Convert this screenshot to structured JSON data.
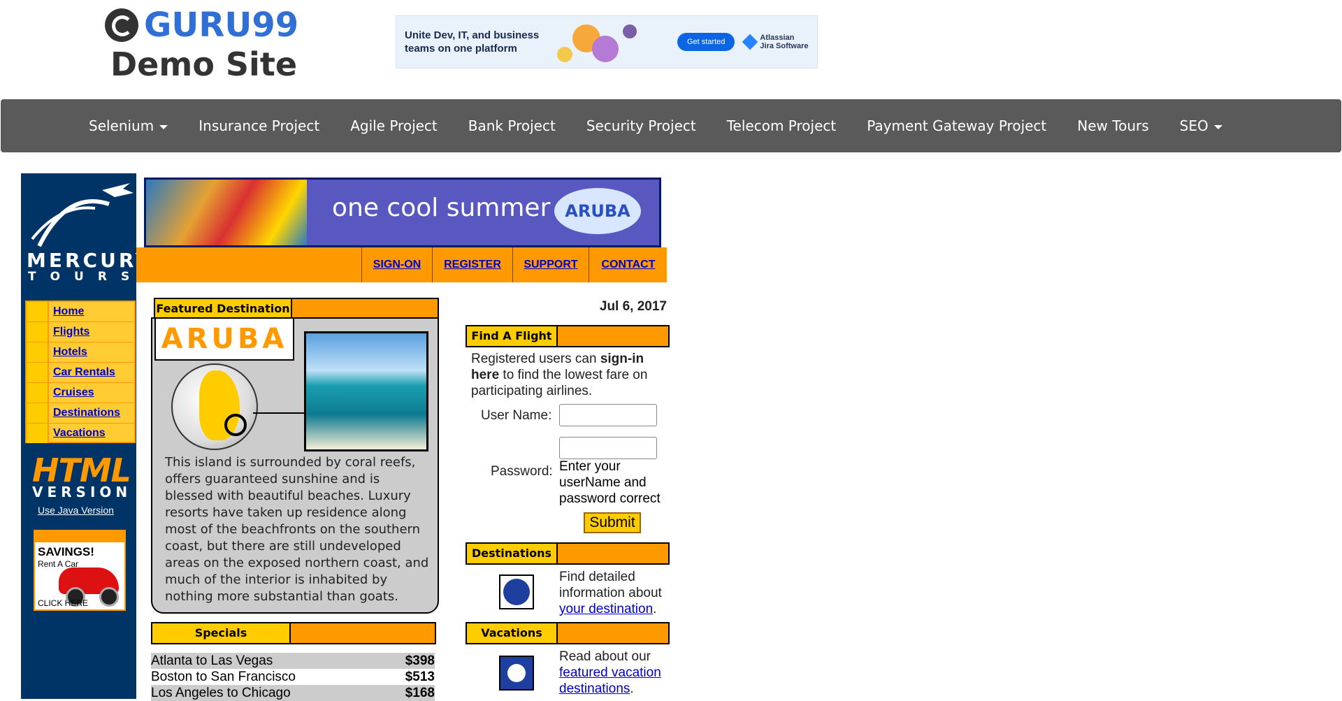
{
  "header": {
    "logo_text": "GURU99",
    "subtitle": "Demo Site"
  },
  "ad": {
    "text": "Unite Dev, IT, and business teams on one platform",
    "button": "Get started",
    "brand_line1": "Atlassian",
    "brand_line2": "Jira Software"
  },
  "nav": {
    "items": [
      {
        "label": "Selenium",
        "dropdown": true
      },
      {
        "label": "Insurance Project"
      },
      {
        "label": "Agile Project"
      },
      {
        "label": "Bank Project"
      },
      {
        "label": "Security Project"
      },
      {
        "label": "Telecom Project"
      },
      {
        "label": "Payment Gateway Project"
      },
      {
        "label": "New Tours"
      },
      {
        "label": "SEO",
        "dropdown": true
      }
    ]
  },
  "mercury": {
    "logo_word": "MERCURY",
    "logo_sub": "TOURS",
    "banner_slogan": "one cool summer",
    "banner_badge": "ARUBA",
    "top_links": [
      "SIGN-ON",
      "REGISTER",
      "SUPPORT",
      "CONTACT"
    ],
    "side_menu": [
      "Home",
      "Flights",
      "Hotels",
      "Car Rentals",
      "Cruises",
      "Destinations",
      "Vacations"
    ],
    "html_version_1": "HTML",
    "html_version_2": "VERSION",
    "java_link": "Use Java Version",
    "savings_1": "SAVINGS!",
    "savings_2": "Rent A Car",
    "savings_3": "CLICK HERE"
  },
  "featured": {
    "header": "Featured Destination",
    "title": "ARUBA",
    "text": "This island is surrounded by coral reefs, offers guaranteed sunshine and is blessed with beautiful beaches. Luxury resorts have taken up residence along most of the beachfronts on the southern coast, but there are still undeveloped areas on the exposed northern coast, and much of the interior is inhabited by nothing more substantial than goats."
  },
  "specials": {
    "header": "Specials",
    "rows": [
      {
        "route": "Atlanta to Las Vegas",
        "price": "$398"
      },
      {
        "route": "Boston to San Francisco",
        "price": "$513"
      },
      {
        "route": "Los Angeles to Chicago",
        "price": "$168"
      }
    ]
  },
  "right": {
    "date": "Jul 6, 2017",
    "flight_header": "Find A Flight",
    "flight_text_1": "Registered users can ",
    "flight_text_bold": "sign-in here",
    "flight_text_2": " to find the lowest fare on participating airlines.",
    "user_label": "User Name:",
    "pass_label": "Password:",
    "pass_hint": "Enter your userName and password correct",
    "submit": "Submit",
    "dest_header": "Destinations",
    "dest_text": "Find detailed information about ",
    "dest_link": "your destination",
    "vac_header": "Vacations",
    "vac_text": "Read about our ",
    "vac_link": "featured vacation destinations"
  }
}
